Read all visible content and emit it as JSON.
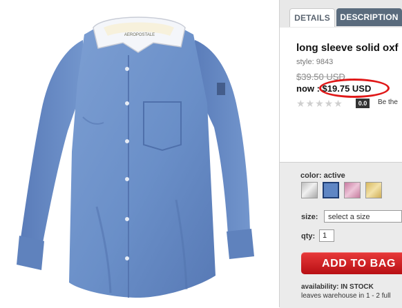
{
  "product": {
    "image_alt": "Light blue long sleeve oxford shirt with white collar",
    "tag_text": "AEROPOSTALE"
  },
  "tabs": [
    {
      "label": "DETAILS"
    },
    {
      "label": "DESCRIPTION"
    }
  ],
  "title": "long sleeve solid oxf",
  "style": "style: 9843",
  "price": {
    "was": "$39.50 USD",
    "now_label": "now : ",
    "now": "$19.75 USD"
  },
  "reviews": {
    "stars": "★★★★★",
    "rating": "0.0",
    "cta": "Be the"
  },
  "options": {
    "color_label": "color: active",
    "swatches": [
      "silver",
      "blue",
      "pink",
      "gold"
    ],
    "size_label": "size:",
    "size_value": "select a size",
    "qty_label": "qty:",
    "qty_value": "1"
  },
  "add_to_bag": "ADD TO BAG",
  "availability": "availability: IN STOCK",
  "shipping": "leaves warehouse in 1 - 2 full",
  "colors": {
    "tab_active_bg": "#5a6b7d",
    "add_to_bag": "#d31f24",
    "highlight_circle": "#e01818",
    "shirt_blue": "#6d91c7"
  }
}
